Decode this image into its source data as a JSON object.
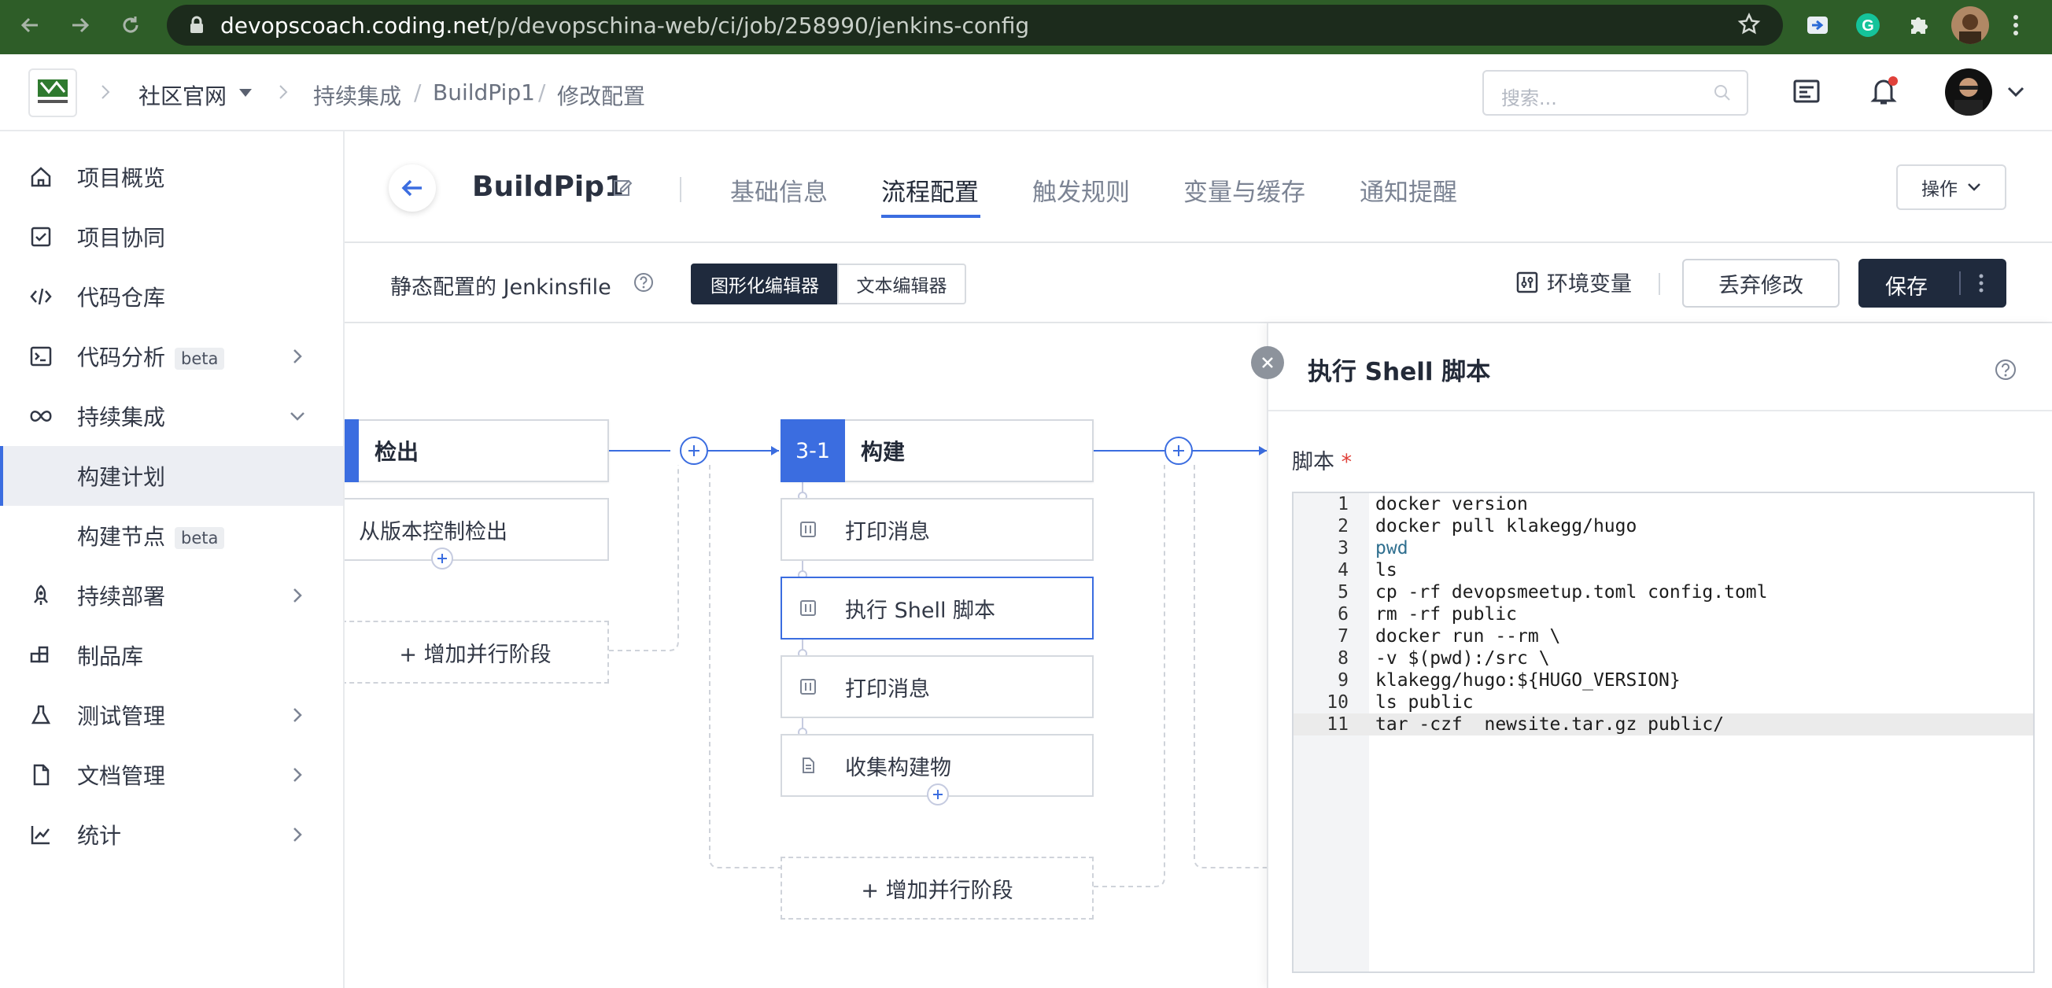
{
  "browser": {
    "url_domain": "devopscoach.coding.net",
    "url_path": "/p/devopschina-web/ci/job/258990/jenkins-config"
  },
  "topbar": {
    "team_name": "社区官网",
    "breadcrumb": [
      "持续集成",
      "BuildPip1",
      "修改配置"
    ],
    "search_placeholder": "搜索..."
  },
  "sidebar": {
    "items": [
      {
        "label": "项目概览",
        "icon": "home-icon"
      },
      {
        "label": "项目协同",
        "icon": "checkbox-icon"
      },
      {
        "label": "代码仓库",
        "icon": "code-icon"
      },
      {
        "label": "代码分析",
        "icon": "terminal-icon",
        "badge": "beta"
      },
      {
        "label": "持续集成",
        "icon": "infinity-icon"
      },
      {
        "label": "构建计划"
      },
      {
        "label": "构建节点",
        "badge": "beta"
      },
      {
        "label": "持续部署",
        "icon": "rocket-icon"
      },
      {
        "label": "制品库",
        "icon": "package-icon"
      },
      {
        "label": "测试管理",
        "icon": "flask-icon"
      },
      {
        "label": "文档管理",
        "icon": "document-icon"
      },
      {
        "label": "统计",
        "icon": "chart-icon"
      }
    ]
  },
  "header": {
    "job_name": "BuildPip1",
    "tabs": [
      "基础信息",
      "流程配置",
      "触发规则",
      "变量与缓存",
      "通知提醒"
    ],
    "active_tab": "流程配置",
    "operations_label": "操作"
  },
  "toolbar": {
    "label": "静态配置的 Jenkinsfile",
    "graphical_editor": "图形化编辑器",
    "text_editor": "文本编辑器",
    "env_vars": "环境变量",
    "discard": "丢弃修改",
    "save": "保存"
  },
  "pipeline": {
    "stage1": {
      "title": "检出",
      "steps": [
        "从版本控制检出"
      ]
    },
    "stage2": {
      "index": "3-1",
      "title": "构建",
      "steps": [
        "打印消息",
        "执行 Shell 脚本",
        "打印消息",
        "收集构建物"
      ]
    },
    "add_parallel": "+ 增加并行阶段"
  },
  "panel": {
    "title": "执行 Shell 脚本",
    "field_label": "脚本",
    "required_mark": "*",
    "script_lines": [
      "docker version",
      "docker pull klakegg/hugo",
      "pwd",
      "ls",
      "cp -rf devopsmeetup.toml config.toml",
      "rm -rf public",
      "docker run --rm \\",
      "-v $(pwd):/src \\",
      "klakegg/hugo:${HUGO_VERSION}",
      "ls public",
      "tar -czf  newsite.tar.gz public/"
    ],
    "line_numbers": [
      "1",
      "2",
      "3",
      "4",
      "5",
      "6",
      "7",
      "8",
      "9",
      "10",
      "11"
    ]
  }
}
